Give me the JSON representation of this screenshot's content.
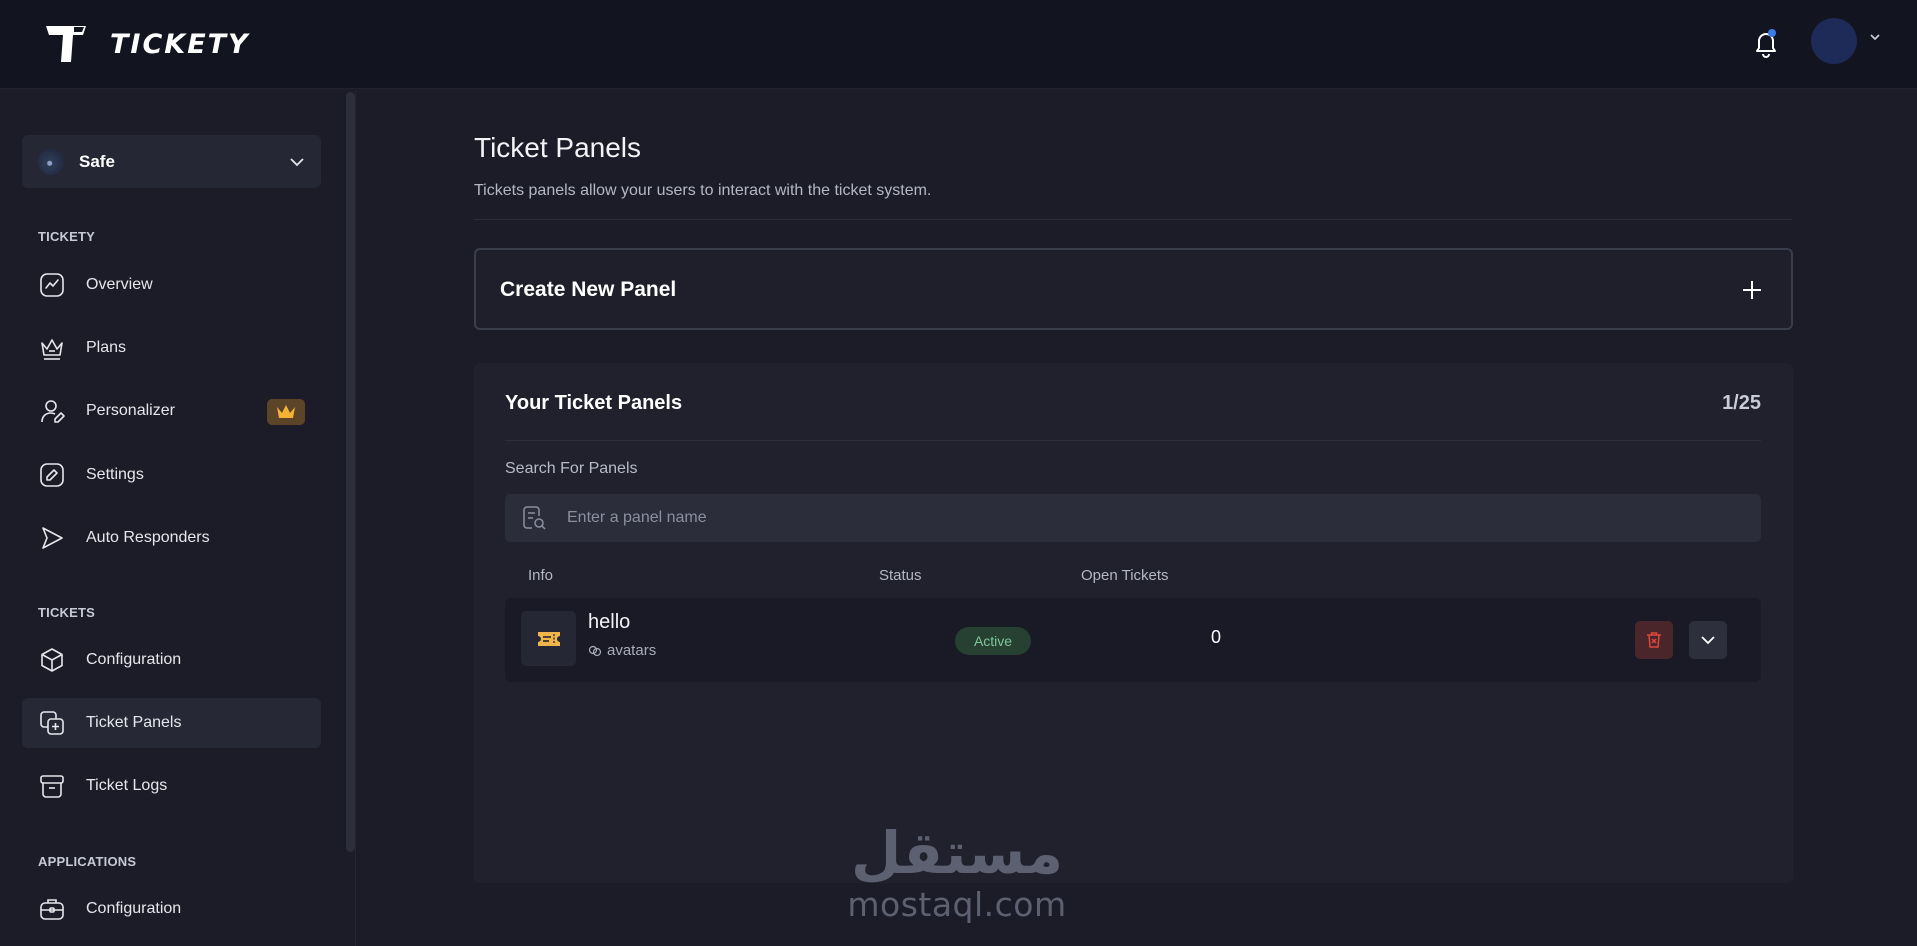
{
  "app": {
    "brand": "TICKETY"
  },
  "header": {
    "notification_icon": "bell-icon",
    "avatar_icon": "user-avatar"
  },
  "sidebar": {
    "server": {
      "name": "Safe"
    },
    "sections": [
      {
        "title": "TICKETY"
      },
      {
        "title": "TICKETS"
      },
      {
        "title": "APPLICATIONS"
      }
    ],
    "items": [
      {
        "label": "Overview",
        "icon": "chart-icon"
      },
      {
        "label": "Plans",
        "icon": "crown-icon"
      },
      {
        "label": "Personalizer",
        "icon": "user-edit-icon",
        "badge": "crown"
      },
      {
        "label": "Settings",
        "icon": "edit-icon"
      },
      {
        "label": "Auto Responders",
        "icon": "send-icon"
      },
      {
        "label": "Configuration",
        "icon": "cube-icon"
      },
      {
        "label": "Ticket Panels",
        "icon": "copy-plus-icon",
        "active": true
      },
      {
        "label": "Ticket Logs",
        "icon": "archive-icon"
      },
      {
        "label": "Configuration",
        "icon": "briefcase-icon"
      }
    ]
  },
  "main": {
    "title": "Ticket Panels",
    "subtitle": "Tickets panels allow your users to interact with the ticket system.",
    "create_panel_label": "Create New Panel",
    "panels": {
      "title": "Your Ticket Panels",
      "count": "1/25",
      "search_label": "Search For Panels",
      "search_placeholder": "Enter a panel name",
      "columns": [
        "Info",
        "Status",
        "Open Tickets"
      ],
      "rows": [
        {
          "name": "hello",
          "sub": "avatars",
          "status": "Active",
          "open_tickets": "0"
        }
      ]
    }
  },
  "watermark": {
    "arabic": "مستقل",
    "latin": "mostaql.com"
  },
  "colors": {
    "active_badge": "#7fc79a",
    "delete": "#e0473f",
    "ticket_icon": "#f0b54a",
    "crown_badge": "#f5b335"
  }
}
